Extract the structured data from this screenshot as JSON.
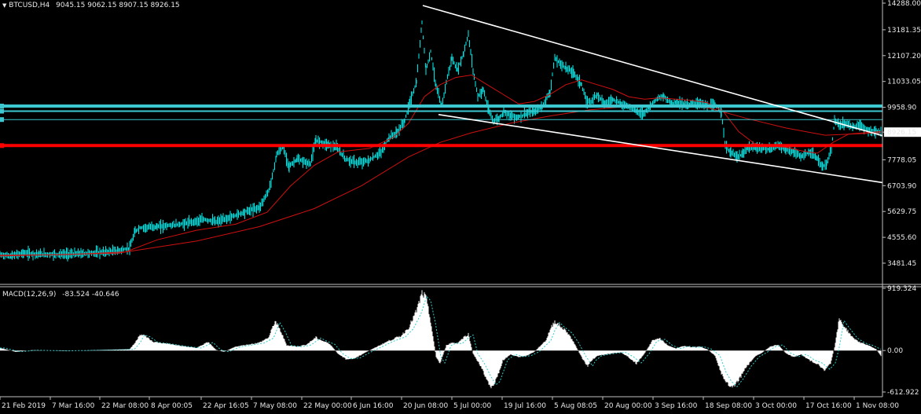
{
  "main_header": {
    "symbol": "BTCUSD,H4",
    "open": "9045.15",
    "high": "9062.15",
    "low": "8907.15",
    "close": "8926.15"
  },
  "macd_header": {
    "label": "MACD(12,26,9)",
    "main": "-83.524",
    "signal": "-40.646"
  },
  "colors": {
    "background": "#000000",
    "candles": "#00e0e0",
    "moving_average": "#d01010",
    "levels_cyan": "#3cc8d0",
    "level_red": "#ff0000",
    "trendline": "#ffffff",
    "macd_histogram": "#ffffff",
    "macd_signal": "#33cccc",
    "axis_text": "#e8e8e8"
  },
  "chart_data": [
    {
      "type": "line",
      "name": "BTCUSD H4 price",
      "x_ticks": [
        "21 Feb 2019",
        "7 Mar 16:00",
        "22 Mar 08:00",
        "8 Apr 00:05",
        "22 Apr 16:05",
        "7 May 08:00",
        "22 May 00:00",
        "6 Jun 16:00",
        "20 Jun 08:00",
        "5 Jul 00:00",
        "19 Jul 16:00",
        "5 Aug 08:05",
        "20 Aug 00:00",
        "3 Sep 16:00",
        "18 Sep 08:00",
        "3 Oct 00:00",
        "17 Oct 16:00",
        "1 Nov 08:00"
      ],
      "y_ticks": [
        "14288.00",
        "13181.35",
        "12107.20",
        "11033.05",
        "9958.90",
        "8926.15",
        "7778.05",
        "6703.90",
        "5629.75",
        "4555.60",
        "3481.45"
      ],
      "ylim": [
        3481.45,
        14288.0
      ],
      "current_price": 8926.15,
      "price_path": [
        [
          0,
          3830
        ],
        [
          14,
          3780
        ],
        [
          30,
          3900
        ],
        [
          50,
          3850
        ],
        [
          80,
          3850
        ],
        [
          100,
          3870
        ],
        [
          130,
          3930
        ],
        [
          150,
          4000
        ],
        [
          165,
          4100
        ],
        [
          172,
          4800
        ],
        [
          178,
          4950
        ],
        [
          200,
          5000
        ],
        [
          230,
          5100
        ],
        [
          260,
          5300
        ],
        [
          275,
          5200
        ],
        [
          290,
          5350
        ],
        [
          310,
          5600
        ],
        [
          330,
          5800
        ],
        [
          342,
          6500
        ],
        [
          348,
          7300
        ],
        [
          352,
          8000
        ],
        [
          360,
          8300
        ],
        [
          368,
          7500
        ],
        [
          378,
          7800
        ],
        [
          395,
          7600
        ],
        [
          402,
          8600
        ],
        [
          418,
          8400
        ],
        [
          428,
          8300
        ],
        [
          440,
          7800
        ],
        [
          455,
          7650
        ],
        [
          470,
          7750
        ],
        [
          485,
          8100
        ],
        [
          495,
          8700
        ],
        [
          505,
          8900
        ],
        [
          515,
          9400
        ],
        [
          522,
          10200
        ],
        [
          530,
          11000
        ],
        [
          537,
          13500
        ],
        [
          542,
          11500
        ],
        [
          548,
          12300
        ],
        [
          555,
          10800
        ],
        [
          562,
          10000
        ],
        [
          568,
          11000
        ],
        [
          575,
          12000
        ],
        [
          582,
          11500
        ],
        [
          590,
          12200
        ],
        [
          596,
          13000
        ],
        [
          602,
          11500
        ],
        [
          608,
          10400
        ],
        [
          615,
          10700
        ],
        [
          622,
          9800
        ],
        [
          628,
          9400
        ],
        [
          635,
          9500
        ],
        [
          642,
          9800
        ],
        [
          650,
          9600
        ],
        [
          660,
          9550
        ],
        [
          670,
          9700
        ],
        [
          680,
          9800
        ],
        [
          690,
          10000
        ],
        [
          700,
          10600
        ],
        [
          706,
          12000
        ],
        [
          712,
          11800
        ],
        [
          720,
          11600
        ],
        [
          730,
          11400
        ],
        [
          740,
          10900
        ],
        [
          746,
          10200
        ],
        [
          752,
          10200
        ],
        [
          760,
          10500
        ],
        [
          770,
          10100
        ],
        [
          780,
          10300
        ],
        [
          790,
          10100
        ],
        [
          800,
          10000
        ],
        [
          810,
          9800
        ],
        [
          818,
          9700
        ],
        [
          826,
          9950
        ],
        [
          835,
          10300
        ],
        [
          845,
          10400
        ],
        [
          855,
          10100
        ],
        [
          862,
          10200
        ],
        [
          870,
          10050
        ],
        [
          880,
          10100
        ],
        [
          890,
          10150
        ],
        [
          900,
          10000
        ],
        [
          910,
          10050
        ],
        [
          918,
          9800
        ],
        [
          923,
          8300
        ],
        [
          930,
          8100
        ],
        [
          938,
          7900
        ],
        [
          945,
          8000
        ],
        [
          952,
          8300
        ],
        [
          962,
          8250
        ],
        [
          970,
          8300
        ],
        [
          980,
          8200
        ],
        [
          990,
          8400
        ],
        [
          1000,
          8200
        ],
        [
          1010,
          8100
        ],
        [
          1020,
          7900
        ],
        [
          1030,
          8100
        ],
        [
          1040,
          7800
        ],
        [
          1047,
          7500
        ],
        [
          1052,
          7600
        ],
        [
          1058,
          8200
        ],
        [
          1062,
          9400
        ],
        [
          1068,
          9200
        ],
        [
          1075,
          9300
        ],
        [
          1085,
          9150
        ],
        [
          1095,
          9200
        ],
        [
          1105,
          9000
        ],
        [
          1115,
          8950
        ],
        [
          1121,
          8926
        ]
      ],
      "ma_path": [
        [
          0,
          3810
        ],
        [
          80,
          3830
        ],
        [
          160,
          3950
        ],
        [
          200,
          4450
        ],
        [
          250,
          4850
        ],
        [
          300,
          5100
        ],
        [
          340,
          5600
        ],
        [
          370,
          6700
        ],
        [
          400,
          7550
        ],
        [
          430,
          8100
        ],
        [
          470,
          8250
        ],
        [
          500,
          8700
        ],
        [
          520,
          9300
        ],
        [
          540,
          10400
        ],
        [
          560,
          10900
        ],
        [
          580,
          11200
        ],
        [
          600,
          11300
        ],
        [
          620,
          10900
        ],
        [
          640,
          10500
        ],
        [
          660,
          10100
        ],
        [
          680,
          10200
        ],
        [
          700,
          10500
        ],
        [
          720,
          10900
        ],
        [
          740,
          11100
        ],
        [
          760,
          10900
        ],
        [
          780,
          10700
        ],
        [
          800,
          10400
        ],
        [
          820,
          10300
        ],
        [
          840,
          10350
        ],
        [
          860,
          10300
        ],
        [
          880,
          10250
        ],
        [
          900,
          10150
        ],
        [
          920,
          9800
        ],
        [
          940,
          8950
        ],
        [
          960,
          8450
        ],
        [
          980,
          8350
        ],
        [
          1000,
          8300
        ],
        [
          1020,
          8150
        ],
        [
          1040,
          8050
        ],
        [
          1060,
          8500
        ],
        [
          1080,
          8850
        ],
        [
          1100,
          8900
        ],
        [
          1121,
          8950
        ]
      ],
      "long_ma_path": [
        [
          0,
          3780
        ],
        [
          150,
          3900
        ],
        [
          250,
          4400
        ],
        [
          330,
          5000
        ],
        [
          400,
          5750
        ],
        [
          460,
          6700
        ],
        [
          520,
          7900
        ],
        [
          560,
          8500
        ],
        [
          600,
          8900
        ],
        [
          650,
          9300
        ],
        [
          700,
          9600
        ],
        [
          750,
          9850
        ],
        [
          800,
          10000
        ],
        [
          850,
          10050
        ],
        [
          900,
          9950
        ],
        [
          950,
          9500
        ],
        [
          1000,
          9100
        ],
        [
          1050,
          8800
        ],
        [
          1121,
          8900
        ]
      ],
      "horizontal_levels": [
        {
          "price": 10010,
          "color": "cyan"
        },
        {
          "price": 9800,
          "color": "cyan"
        },
        {
          "price": 9450,
          "color": "cyan"
        },
        {
          "price": 8370,
          "color": "red"
        }
      ],
      "trendlines": [
        {
          "from": [
            538,
            14190
          ],
          "to": [
            1123,
            8780
          ]
        },
        {
          "from": [
            558,
            9660
          ],
          "to": [
            1123,
            6830
          ]
        }
      ]
    },
    {
      "type": "bar",
      "name": "MACD(12,26,9)",
      "ylim": [
        -612.922,
        919.324
      ],
      "y_ticks": [
        "919.324",
        "0.00",
        "-612.922"
      ],
      "histogram_path": [
        [
          0,
          40
        ],
        [
          10,
          10
        ],
        [
          20,
          -20
        ],
        [
          40,
          5
        ],
        [
          80,
          -5
        ],
        [
          120,
          5
        ],
        [
          150,
          15
        ],
        [
          165,
          20
        ],
        [
          172,
          120
        ],
        [
          178,
          250
        ],
        [
          185,
          220
        ],
        [
          195,
          130
        ],
        [
          210,
          110
        ],
        [
          230,
          70
        ],
        [
          250,
          40
        ],
        [
          265,
          130
        ],
        [
          275,
          10
        ],
        [
          285,
          -20
        ],
        [
          300,
          60
        ],
        [
          315,
          90
        ],
        [
          330,
          120
        ],
        [
          342,
          200
        ],
        [
          350,
          450
        ],
        [
          357,
          300
        ],
        [
          365,
          80
        ],
        [
          378,
          60
        ],
        [
          390,
          90
        ],
        [
          402,
          200
        ],
        [
          410,
          150
        ],
        [
          420,
          100
        ],
        [
          430,
          -50
        ],
        [
          440,
          -130
        ],
        [
          452,
          -120
        ],
        [
          465,
          -30
        ],
        [
          480,
          60
        ],
        [
          495,
          150
        ],
        [
          510,
          220
        ],
        [
          520,
          350
        ],
        [
          530,
          600
        ],
        [
          537,
          870
        ],
        [
          542,
          800
        ],
        [
          548,
          450
        ],
        [
          555,
          -100
        ],
        [
          560,
          -200
        ],
        [
          568,
          80
        ],
        [
          575,
          120
        ],
        [
          582,
          110
        ],
        [
          590,
          200
        ],
        [
          596,
          250
        ],
        [
          602,
          -50
        ],
        [
          610,
          -200
        ],
        [
          618,
          -400
        ],
        [
          625,
          -550
        ],
        [
          630,
          -500
        ],
        [
          640,
          -150
        ],
        [
          650,
          -60
        ],
        [
          660,
          -100
        ],
        [
          670,
          -80
        ],
        [
          680,
          -20
        ],
        [
          695,
          160
        ],
        [
          700,
          320
        ],
        [
          706,
          450
        ],
        [
          712,
          380
        ],
        [
          722,
          280
        ],
        [
          730,
          130
        ],
        [
          740,
          -100
        ],
        [
          748,
          -250
        ],
        [
          752,
          -160
        ],
        [
          760,
          -80
        ],
        [
          770,
          -60
        ],
        [
          780,
          -40
        ],
        [
          790,
          -30
        ],
        [
          800,
          -100
        ],
        [
          810,
          -200
        ],
        [
          820,
          -50
        ],
        [
          830,
          150
        ],
        [
          840,
          180
        ],
        [
          850,
          80
        ],
        [
          860,
          30
        ],
        [
          870,
          70
        ],
        [
          880,
          50
        ],
        [
          890,
          60
        ],
        [
          900,
          20
        ],
        [
          910,
          -80
        ],
        [
          918,
          -350
        ],
        [
          925,
          -500
        ],
        [
          932,
          -580
        ],
        [
          940,
          -450
        ],
        [
          950,
          -250
        ],
        [
          960,
          -100
        ],
        [
          970,
          -30
        ],
        [
          980,
          60
        ],
        [
          990,
          90
        ],
        [
          1000,
          -40
        ],
        [
          1010,
          -100
        ],
        [
          1020,
          -60
        ],
        [
          1030,
          -150
        ],
        [
          1040,
          -200
        ],
        [
          1050,
          -300
        ],
        [
          1057,
          -200
        ],
        [
          1062,
          50
        ],
        [
          1068,
          480
        ],
        [
          1075,
          360
        ],
        [
          1085,
          200
        ],
        [
          1095,
          120
        ],
        [
          1105,
          80
        ],
        [
          1115,
          20
        ],
        [
          1121,
          -84
        ]
      ]
    }
  ]
}
